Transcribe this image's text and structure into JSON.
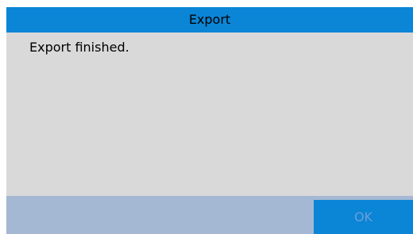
{
  "dialog": {
    "title": "Export",
    "message": "Export finished.",
    "ok_label": "OK"
  },
  "colors": {
    "titlebar": "#0b85d6",
    "body": "#d9d9d9",
    "footer": "#a5b8d3",
    "button": "#0b85d6",
    "button_text": "#6a9ed8"
  }
}
